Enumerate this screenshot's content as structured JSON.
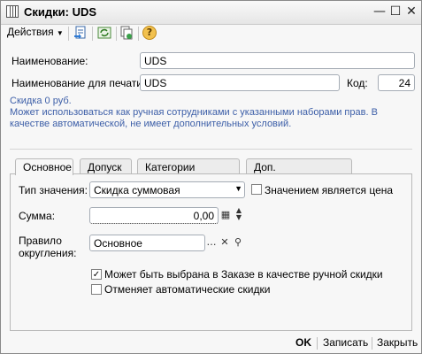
{
  "window": {
    "title": "Скидки: UDS"
  },
  "title_buttons": {
    "minimize": "—",
    "maximize": "☐",
    "close": "✕"
  },
  "toolbar": {
    "actions_label": "Действия",
    "help_icon": "?"
  },
  "form": {
    "name_label": "Наименование:",
    "name_value": "UDS",
    "print_name_label": "Наименование для печати:",
    "print_name_value": "UDS",
    "code_label": "Код:",
    "code_value": "24"
  },
  "info": {
    "line1": "Скидка 0 руб.",
    "line2": "Может использоваться как ручная сотрудниками с указанными наборами прав. В качестве автоматической, не имеет дополнительных условий."
  },
  "tabs": [
    {
      "label": "Основное"
    },
    {
      "label": "Допуск"
    },
    {
      "label": "Категории товаров"
    },
    {
      "label": "Доп. наименования"
    }
  ],
  "main": {
    "value_type_label": "Тип значения:",
    "value_type_selected": "Скидка суммовая",
    "is_price_label": "Значением является цена",
    "sum_label": "Сумма:",
    "sum_value": "0,00",
    "rounding_label_1": "Правило",
    "rounding_label_2": "округления:",
    "rounding_value": "Основное",
    "manual_discount_label": "Может быть выбрана в Заказе в качестве ручной скидки",
    "manual_discount_checked": true,
    "cancels_auto_label": "Отменяет автоматические скидки",
    "cancels_auto_checked": false
  },
  "bottom": {
    "ok": "OK",
    "save": "Записать",
    "close": "Закрыть"
  },
  "colors": {
    "info_text": "#3d5fa8"
  }
}
